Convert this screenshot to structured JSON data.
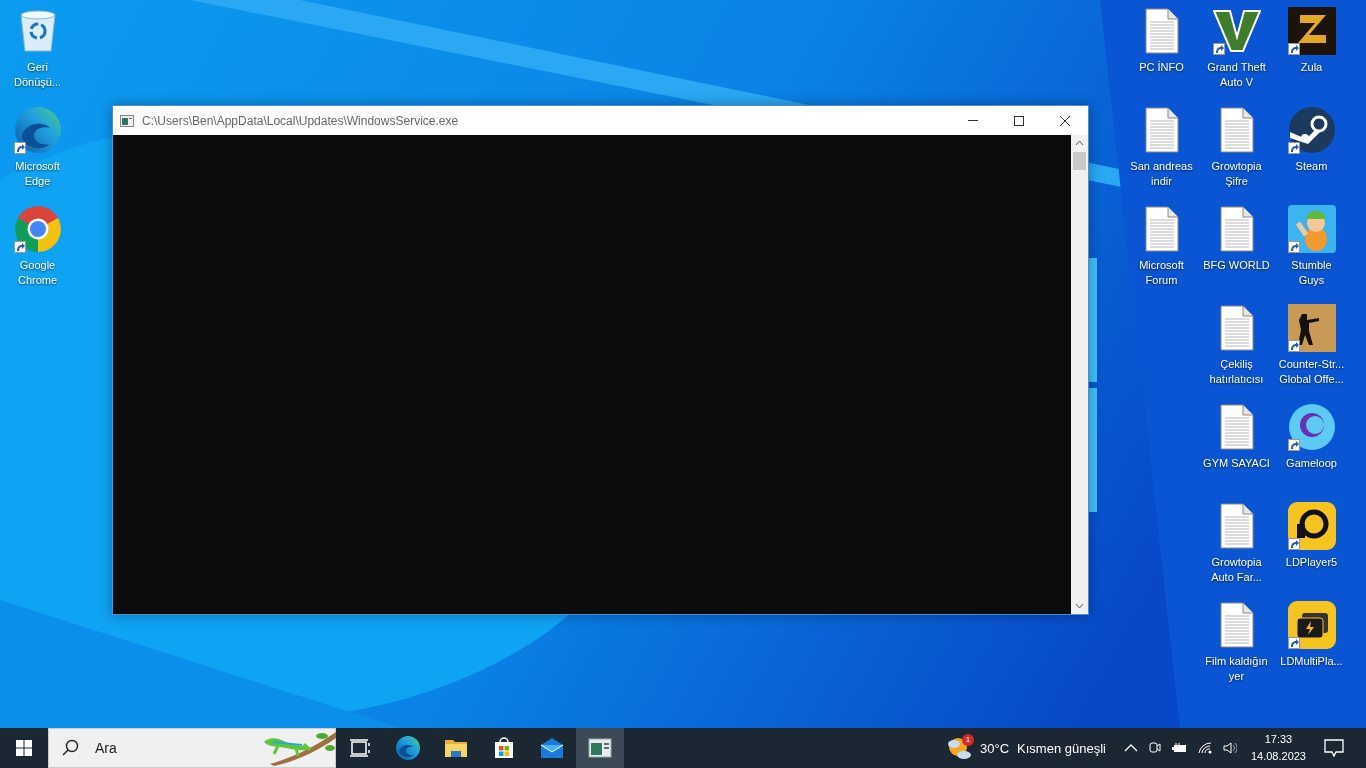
{
  "desktop": {
    "left_icons": [
      {
        "label": "Geri\nDönüşü...",
        "kind": "recycle-bin",
        "shortcut": false
      },
      {
        "label": "Microsoft\nEdge",
        "kind": "edge",
        "shortcut": true
      },
      {
        "label": "Google\nChrome",
        "kind": "chrome",
        "shortcut": true
      }
    ],
    "right_columns": [
      {
        "icons": [
          {
            "label": "PC İNFO",
            "kind": "document",
            "shortcut": false
          },
          {
            "label": "San andreas\nindir",
            "kind": "document",
            "shortcut": false
          },
          {
            "label": "Microsoft\nForum",
            "kind": "document",
            "shortcut": false
          }
        ]
      },
      {
        "icons": [
          {
            "label": "Grand Theft\nAuto V",
            "kind": "v-logo",
            "shortcut": true
          },
          {
            "label": "Growtopia\nŞifre",
            "kind": "document",
            "shortcut": false
          },
          {
            "label": "BFG WORLD",
            "kind": "document",
            "shortcut": false
          },
          {
            "label": "Çekiliş\nhatırlatıcısı",
            "kind": "document",
            "shortcut": false
          },
          {
            "label": "GYM SAYACI",
            "kind": "document",
            "shortcut": false
          },
          {
            "label": "Growtopia\nAuto Far...",
            "kind": "document",
            "shortcut": false
          },
          {
            "label": "Film kaldığın\nyer",
            "kind": "document",
            "shortcut": false
          }
        ]
      },
      {
        "icons": [
          {
            "label": "Zula",
            "kind": "zigzag",
            "shortcut": true
          },
          {
            "label": "Steam",
            "kind": "steam",
            "shortcut": true
          },
          {
            "label": "Stumble\nGuys",
            "kind": "figure",
            "shortcut": true
          },
          {
            "label": "Counter-Str...\nGlobal Offe...",
            "kind": "soldier",
            "shortcut": true
          },
          {
            "label": "Gameloop",
            "kind": "crescent",
            "shortcut": true
          },
          {
            "label": "LDPlayer5",
            "kind": "lightning",
            "shortcut": true
          },
          {
            "label": "LDMultiPla...",
            "kind": "lightning-stack",
            "shortcut": true
          }
        ]
      }
    ]
  },
  "console_window": {
    "title": "C:\\Users\\Ben\\AppData\\Local\\Updates\\WindowsService.exe"
  },
  "taskbar": {
    "search": {
      "placeholder": "Ara"
    },
    "apps": [
      {
        "kind": "task-view",
        "selected": false
      },
      {
        "kind": "edge",
        "selected": false
      },
      {
        "kind": "folder",
        "selected": false
      },
      {
        "kind": "store",
        "selected": false
      },
      {
        "kind": "mail",
        "selected": false
      },
      {
        "kind": "console",
        "selected": true
      }
    ],
    "weather": {
      "badge": "1",
      "temperature": "30°C",
      "condition": "Kısmen güneşli"
    },
    "clock": {
      "time": "17:33",
      "date": "14.08.2023"
    }
  }
}
